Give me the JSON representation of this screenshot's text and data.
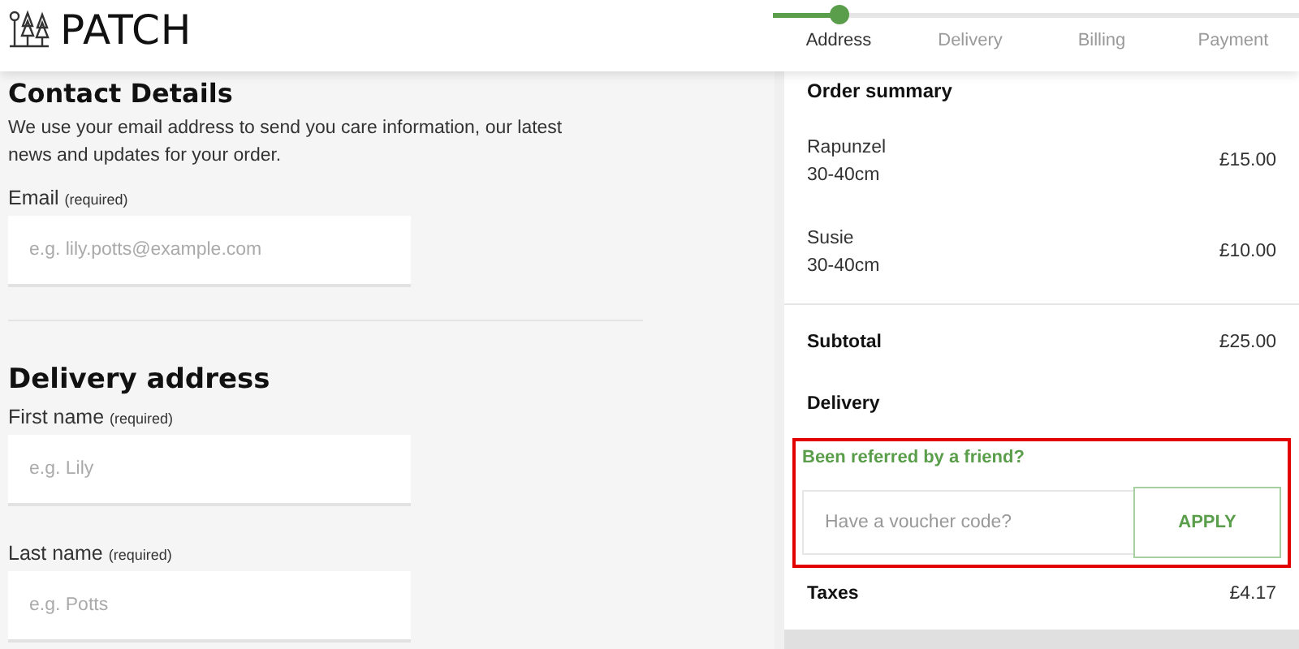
{
  "header": {
    "logo": "PATCH"
  },
  "steps": [
    {
      "label": "Address",
      "selected": true
    },
    {
      "label": "Delivery",
      "selected": false
    },
    {
      "label": "Billing",
      "selected": false
    },
    {
      "label": "Payment",
      "selected": false
    }
  ],
  "contact": {
    "heading": "Contact Details",
    "intro": "We use your email address to send you care information, our latest news and updates for your order.",
    "fields": [
      {
        "label": "Email",
        "note": "(required)",
        "placeholder": "e.g. lily.potts@example.com"
      }
    ]
  },
  "delivery": {
    "heading": "Delivery address",
    "fields": [
      {
        "label": "First name",
        "note": "(required)",
        "placeholder": "e.g. Lily"
      },
      {
        "label": "Last name",
        "note": "(required)",
        "placeholder": "e.g. Potts"
      }
    ]
  },
  "summary": {
    "heading": "Order summary",
    "items": [
      {
        "name": "Rapunzel",
        "size": "30-40cm",
        "price": "£15.00"
      },
      {
        "name": "Susie",
        "size": "30-40cm",
        "price": "£10.00"
      }
    ],
    "subtotal_label": "Subtotal",
    "subtotal": "£25.00",
    "delivery_label": "Delivery",
    "referral": "Been referred by a friend?",
    "voucher_placeholder": "Have a voucher code?",
    "apply": "APPLY",
    "taxes_label": "Taxes",
    "taxes": "£4.17"
  }
}
